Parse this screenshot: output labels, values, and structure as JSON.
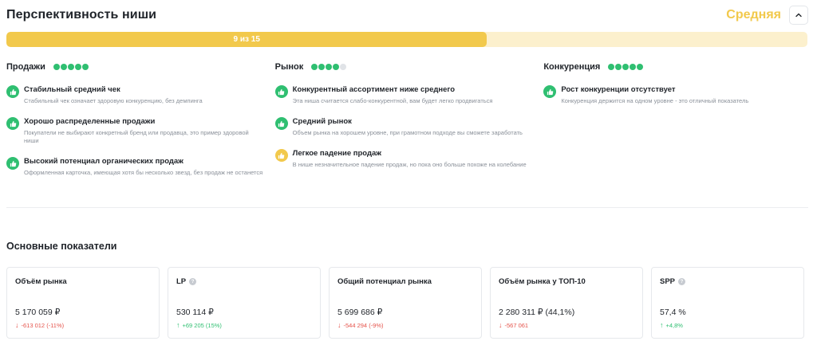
{
  "header": {
    "title": "Перспективность ниши",
    "level": "Средняя",
    "level_color": "#f2c94c"
  },
  "progress": {
    "text": "9 из 15",
    "value": 9,
    "max": 15
  },
  "columns": [
    {
      "title": "Продажи",
      "rating": 5,
      "items": [
        {
          "status": "good",
          "icon": "thumbs-up-icon",
          "title": "Стабильный средний чек",
          "desc": "Стабильный чек означает здоровую конкуренцию, без демпинга"
        },
        {
          "status": "good",
          "icon": "thumbs-up-icon",
          "title": "Хорошо распределенные продажи",
          "desc": "Покупатели не выбирают конкретный бренд или продавца, это пример здоровой ниши"
        },
        {
          "status": "good",
          "icon": "thumbs-up-icon",
          "title": "Высокий потенциал органических продаж",
          "desc": "Оформленная карточка, имеющая хотя бы несколько звезд, без продаж не останется"
        }
      ]
    },
    {
      "title": "Рынок",
      "rating": 4,
      "items": [
        {
          "status": "good",
          "icon": "thumbs-up-icon",
          "title": "Конкурентный ассортимент ниже среднего",
          "desc": "Эта ниша считается слабо-конкурентной, вам будет легко продвигаться"
        },
        {
          "status": "good",
          "icon": "thumbs-up-icon",
          "title": "Средний рынок",
          "desc": "Объем рынка на хорошем уровне, при грамотном подходе вы сможете заработать"
        },
        {
          "status": "warn",
          "icon": "thumbs-up-icon",
          "title": "Легкое падение продаж",
          "desc": "В нише незначительное падение продаж, но пока оно больше похоже на колебание"
        }
      ]
    },
    {
      "title": "Конкуренция",
      "rating": 5,
      "items": [
        {
          "status": "good",
          "icon": "thumbs-up-icon",
          "title": "Рост конкуренции отсутствует",
          "desc": "Конкуренция держится на одном уровне - это отличный показатель"
        }
      ]
    }
  ],
  "metrics": {
    "title": "Основные показатели",
    "cards": [
      {
        "title": "Объём рынка",
        "help": false,
        "value": "5 170 059 ₽",
        "change": "-613 012 (-11%)",
        "direction": "down"
      },
      {
        "title": "LP",
        "help": true,
        "value": "530 114 ₽",
        "change": "+69 205 (15%)",
        "direction": "up"
      },
      {
        "title": "Общий потенциал рынка",
        "help": false,
        "value": "5 699 686 ₽",
        "change": "-544 294 (-9%)",
        "direction": "down"
      },
      {
        "title": "Объём рынка у ТОП-10",
        "help": false,
        "value": "2 280 311 ₽  (44,1%)",
        "change": "-567 061",
        "direction": "down"
      },
      {
        "title": "SPP",
        "help": true,
        "value": "57,4 %",
        "change": "+4,8%",
        "direction": "up"
      }
    ]
  },
  "colors": {
    "good": "#2fbf71",
    "warn": "#f2c94c",
    "down": "#e5534b",
    "up": "#2fbf71"
  }
}
